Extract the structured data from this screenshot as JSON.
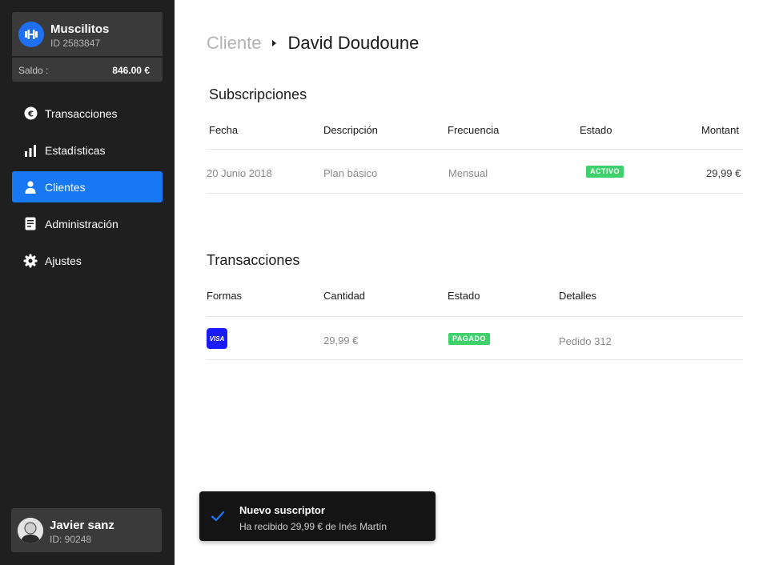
{
  "account": {
    "name": "Muscilitos",
    "id": "ID 2583847",
    "logo_icon": "dumbbell-icon",
    "balance_label": "Saldo :",
    "balance_value": "846.00 €"
  },
  "nav": {
    "items": [
      {
        "label": "Transacciones",
        "icon": "euro-icon",
        "active": false
      },
      {
        "label": "Estadísticas",
        "icon": "bar-chart-icon",
        "active": false
      },
      {
        "label": "Clientes",
        "icon": "user-icon",
        "active": true
      },
      {
        "label": "Administración",
        "icon": "document-icon",
        "active": false
      },
      {
        "label": "Ajustes",
        "icon": "gear-icon",
        "active": false
      }
    ]
  },
  "user": {
    "name": "Javier sanz",
    "id": "ID: 90248"
  },
  "breadcrumb": {
    "parent": "Cliente",
    "current": "David Doudoune"
  },
  "subscriptions": {
    "title": "Subscripciones",
    "headers": [
      "Fecha",
      "Descripción",
      "Frecuencia",
      "Estado",
      "Montant"
    ],
    "rows": [
      {
        "fecha": "20 Junio 2018",
        "descripcion": "Plan básico",
        "frecuencia": "Mensual",
        "estado": "ACTIVO",
        "montant": "29,99 €"
      }
    ]
  },
  "transactions": {
    "title": "Transacciones",
    "headers": [
      "Formas",
      "Cantidad",
      "Estado",
      "Detalles"
    ],
    "rows": [
      {
        "forma": "VISA",
        "cantidad": "29,99 €",
        "estado": "PAGADO",
        "detalles": "Pedido 312"
      }
    ]
  },
  "toast": {
    "title": "Nuevo suscriptor",
    "message": "Ha recibido 29,99 € de Inés Martín"
  },
  "colors": {
    "sidebar": "#1f1f1f",
    "accent": "#1877f2",
    "success": "#3ed16b",
    "visa": "#1a1aff"
  }
}
